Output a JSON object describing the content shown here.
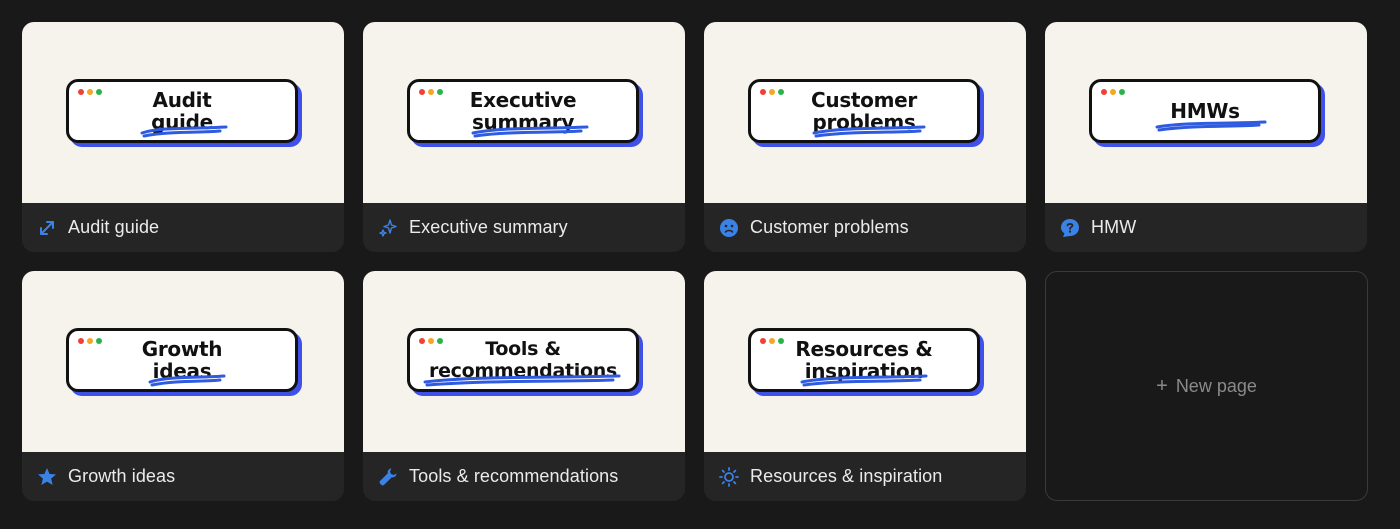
{
  "cards": [
    {
      "badge": [
        "Audit",
        "guide"
      ],
      "label": "Audit guide",
      "icon": "arrows-icon"
    },
    {
      "badge": [
        "Executive",
        "summary"
      ],
      "label": "Executive summary",
      "icon": "sparkles-icon"
    },
    {
      "badge": [
        "Customer",
        "problems"
      ],
      "label": "Customer problems",
      "icon": "sad-face-icon"
    },
    {
      "badge": [
        "HMWs"
      ],
      "label": "HMW",
      "icon": "question-bubble-icon"
    },
    {
      "badge": [
        "Growth",
        "ideas"
      ],
      "label": "Growth ideas",
      "icon": "star-icon"
    },
    {
      "badge": [
        "Tools  &",
        "recommendations"
      ],
      "label": "Tools & recommendations",
      "icon": "wrench-icon"
    },
    {
      "badge": [
        "Resources &",
        "inspiration"
      ],
      "label": "Resources & inspiration",
      "icon": "sun-icon"
    }
  ],
  "new_page": {
    "plus": "+",
    "label": "New page"
  },
  "colors": {
    "background": "#191919",
    "card_caption": "#252525",
    "cover": "#f5f3ec",
    "accent_blue": "#3f51e8",
    "icon_blue": "#2f7fe0"
  }
}
